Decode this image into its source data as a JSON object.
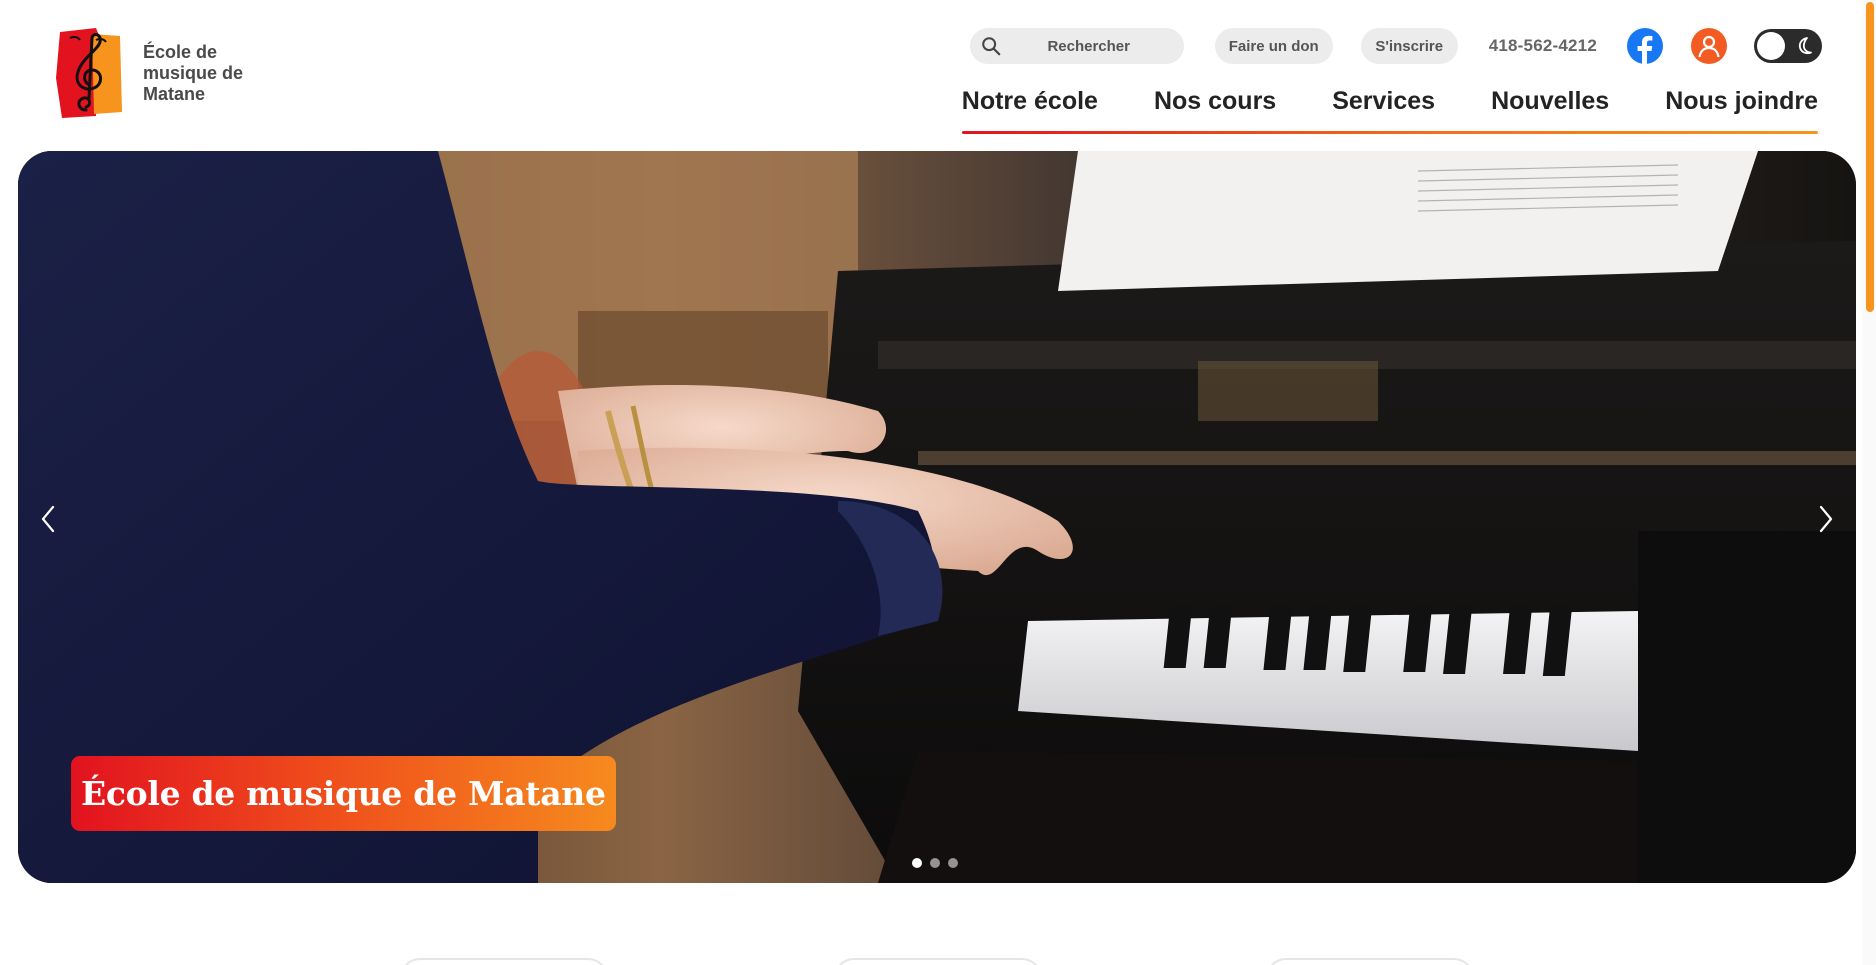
{
  "brand": {
    "name": "École de musique de Matane",
    "logo_icon": "treble-clef-logo",
    "colors": {
      "red": "#e2121f",
      "orange": "#f68a1e"
    }
  },
  "topbar": {
    "search_placeholder": "Rechercher",
    "donate_label": "Faire un don",
    "register_label": "S'inscrire",
    "phone": "418-562-4212",
    "facebook_icon": "facebook-icon",
    "account_icon": "user-icon",
    "theme_toggle_icon": "moon-icon"
  },
  "nav": {
    "items": [
      "Notre école",
      "Nos cours",
      "Services",
      "Nouvelles",
      "Nous joindre"
    ]
  },
  "hero": {
    "caption": "École de musique de Matane",
    "slide_count": 3,
    "active_slide": 1,
    "prev_icon": "chevron-left-icon",
    "next_icon": "chevron-right-icon"
  }
}
